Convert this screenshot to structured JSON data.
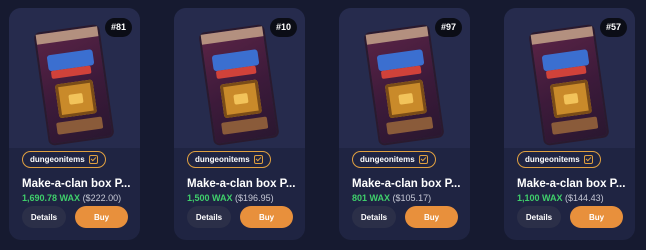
{
  "cards": [
    {
      "badge": "#81",
      "collection": "dungeonitems",
      "name": "Make-a-clan box P...",
      "price_wax": "1,690.78 WAX",
      "price_usd": "($222.00)",
      "details_label": "Details",
      "buy_label": "Buy"
    },
    {
      "badge": "#10",
      "collection": "dungeonitems",
      "name": "Make-a-clan box P...",
      "price_wax": "1,500 WAX",
      "price_usd": "($196.95)",
      "details_label": "Details",
      "buy_label": "Buy"
    },
    {
      "badge": "#97",
      "collection": "dungeonitems",
      "name": "Make-a-clan box P...",
      "price_wax": "801 WAX",
      "price_usd": "($105.17)",
      "details_label": "Details",
      "buy_label": "Buy"
    },
    {
      "badge": "#57",
      "collection": "dungeonitems",
      "name": "Make-a-clan box P...",
      "price_wax": "1,100 WAX",
      "price_usd": "($144.43)",
      "details_label": "Details",
      "buy_label": "Buy"
    }
  ],
  "colors": {
    "background": "#161a30",
    "card": "#1f2442",
    "accent": "#e8903c",
    "wax_green": "#3fcf6b"
  },
  "icons": {
    "verified": "verified-check-icon"
  }
}
